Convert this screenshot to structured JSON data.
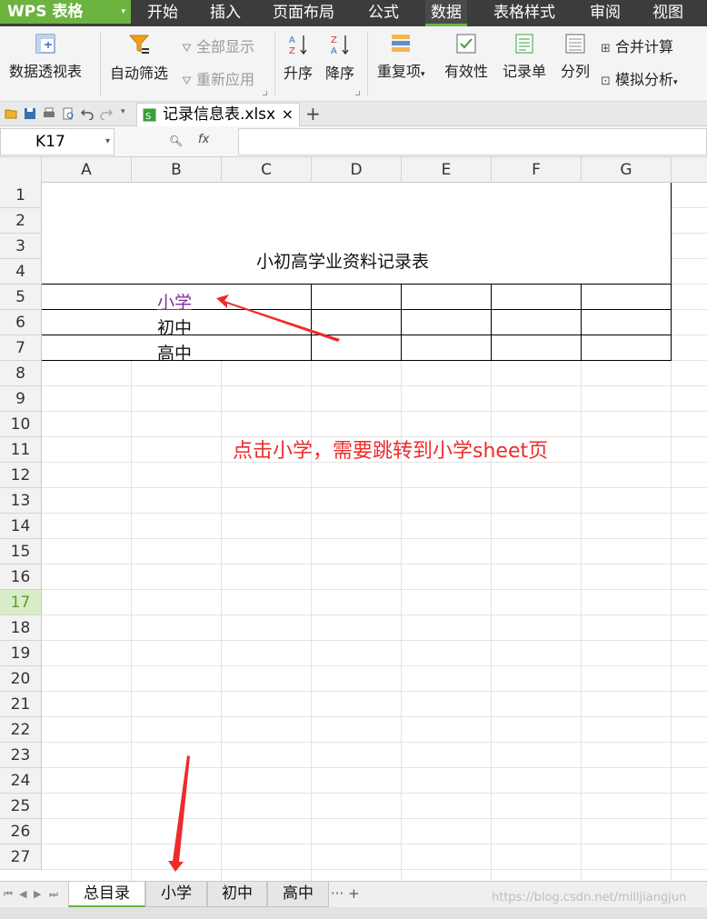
{
  "app": {
    "logo": "WPS 表格"
  },
  "menu": [
    {
      "label": "开始",
      "active": false
    },
    {
      "label": "插入",
      "active": false
    },
    {
      "label": "页面布局",
      "active": false
    },
    {
      "label": "公式",
      "active": false
    },
    {
      "label": "数据",
      "active": true
    },
    {
      "label": "表格样式",
      "active": false
    },
    {
      "label": "审阅",
      "active": false
    },
    {
      "label": "视图",
      "active": false
    }
  ],
  "ribbon": {
    "pivot": "数据透视表",
    "autofilter": "自动筛选",
    "show_all": "全部显示",
    "reapply": "重新应用",
    "sort_asc": "升序",
    "sort_desc": "降序",
    "duplicates": "重复项",
    "validation": "有效性",
    "record_form": "记录单",
    "split_column": "分列",
    "consolidate": "合并计算",
    "what_if": "模拟分析"
  },
  "doc_tab": {
    "name": "记录信息表.xlsx",
    "close": "×",
    "add": "+"
  },
  "formula_bar": {
    "name_box": "K17",
    "fx": "fx",
    "formula": ""
  },
  "columns": [
    "A",
    "B",
    "C",
    "D",
    "E",
    "F",
    "G"
  ],
  "rows": [
    "1",
    "2",
    "3",
    "4",
    "5",
    "6",
    "7",
    "8",
    "9",
    "10",
    "11",
    "12",
    "13",
    "14",
    "15",
    "16",
    "17",
    "18",
    "19",
    "20",
    "21",
    "22",
    "23",
    "24",
    "25",
    "26",
    "27"
  ],
  "selected_row": "17",
  "sheet": {
    "title": "小初高学业资料记录表",
    "links": [
      "小学",
      "初中",
      "高中"
    ]
  },
  "annotation": "点击小学，需要跳转到小学sheet页",
  "sheet_tabs": [
    {
      "label": "总目录",
      "active": true
    },
    {
      "label": "小学",
      "active": false
    },
    {
      "label": "初中",
      "active": false
    },
    {
      "label": "高中",
      "active": false
    }
  ],
  "sheet_tab_more": "··· +",
  "watermark": "https://blog.csdn.net/milljiangjun",
  "colors": {
    "brand": "#6cb33f",
    "menubar": "#3c3c3c",
    "annotation": "#ee2b2b",
    "link": "#7d2e9e"
  }
}
